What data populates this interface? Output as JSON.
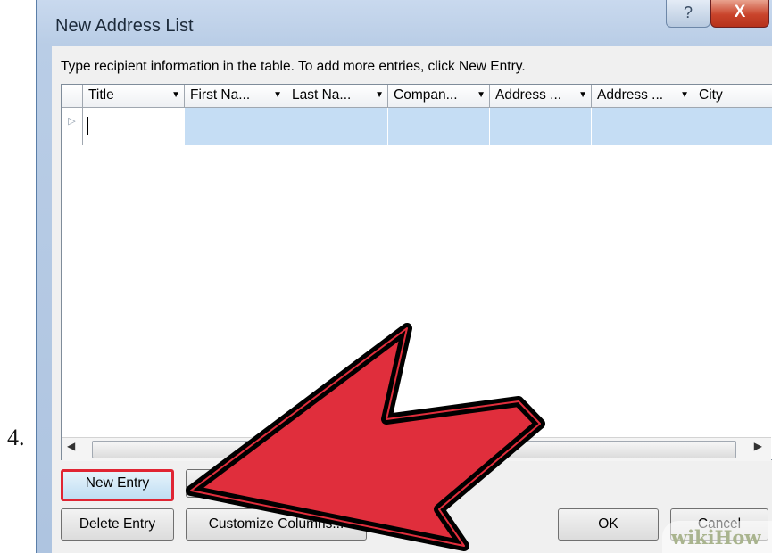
{
  "step_number": "4.",
  "window": {
    "title": "New Address List",
    "help_icon": "?",
    "close_icon": "X"
  },
  "instruction": "Type recipient information in the table.  To add more entries, click New Entry.",
  "table": {
    "columns": [
      "Title",
      "First Na...",
      "Last Na...",
      "Compan...",
      "Address ...",
      "Address ...",
      "City"
    ],
    "rows": [
      [
        "",
        "",
        "",
        "",
        "",
        "",
        ""
      ]
    ]
  },
  "buttons": {
    "new_entry": "New Entry",
    "delete_entry": "Delete Entry",
    "customize_columns": "Customize Columns...",
    "ok": "OK",
    "cancel": "Cancel"
  },
  "watermark": "wikiHow",
  "colors": {
    "highlight_border": "#e02533",
    "arrow_fill": "#e02e3c",
    "row_fill": "#c5ddf4"
  }
}
